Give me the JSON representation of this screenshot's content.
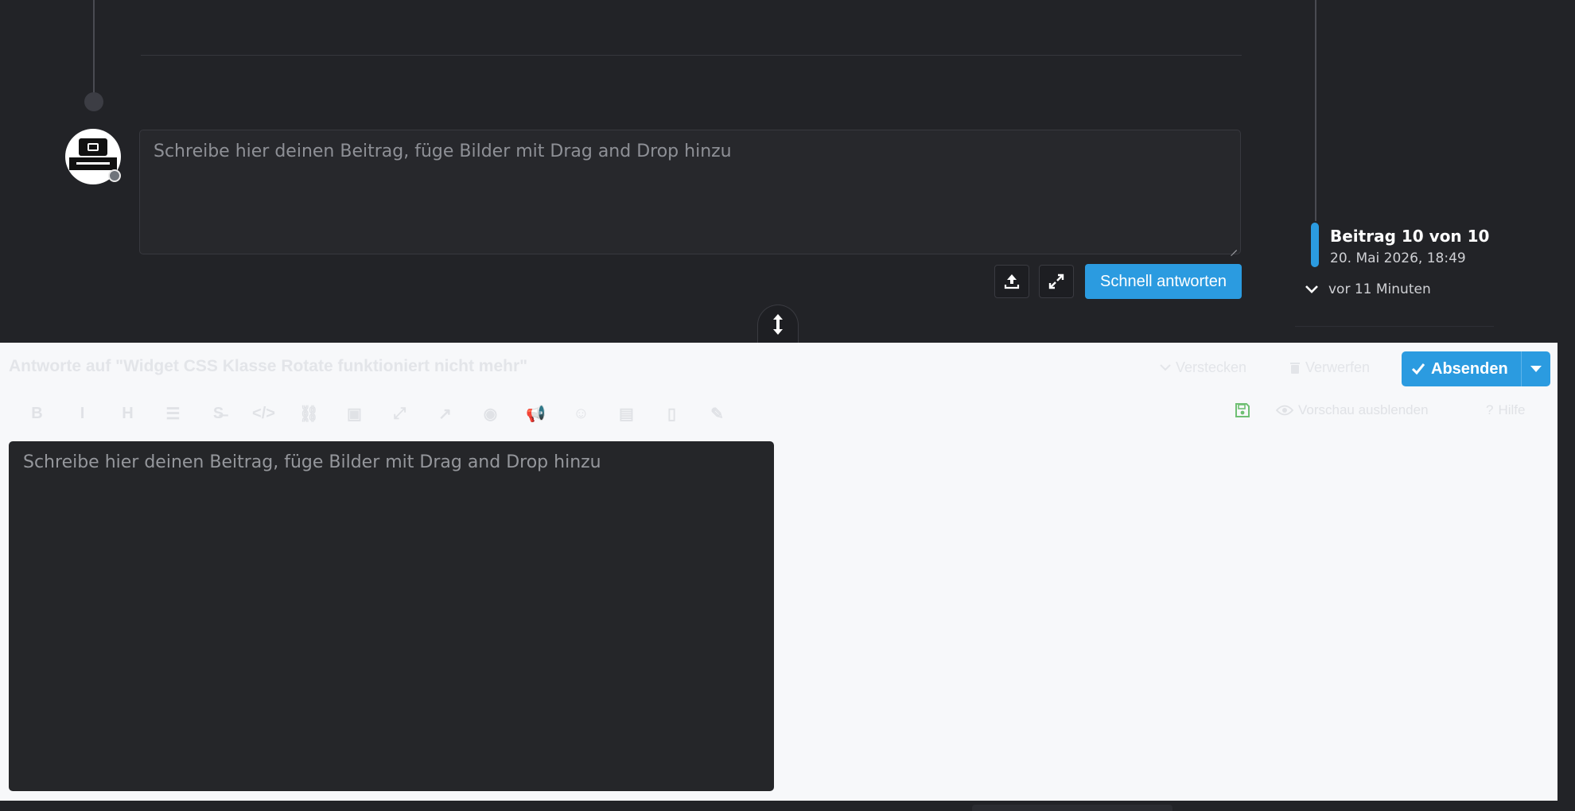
{
  "quick_reply": {
    "placeholder": "Schreibe hier deinen Beitrag, füge Bilder mit Drag and Drop hinzu",
    "submit_label": "Schnell antworten"
  },
  "timeline": {
    "position": "Beitrag 10 von 10",
    "date": "20. Mai 2026, 18:49",
    "ago": "vor 11 Minuten"
  },
  "composer": {
    "title": "Antworte auf \"Widget CSS Klasse Rotate funktioniert nicht mehr\"",
    "hide_label": "Verstecken",
    "discard_label": "Verwerfen",
    "submit_label": "Absenden",
    "toolbar": [
      {
        "icon": "bold-icon",
        "glyph": "B"
      },
      {
        "icon": "italic-icon",
        "glyph": "I"
      },
      {
        "icon": "heading-icon",
        "glyph": "H"
      },
      {
        "icon": "list-icon",
        "glyph": "☰"
      },
      {
        "icon": "strikethrough-icon",
        "glyph": "S̶"
      },
      {
        "icon": "code-icon",
        "glyph": "</>"
      },
      {
        "icon": "link-icon",
        "glyph": "⛓"
      },
      {
        "icon": "image-icon",
        "glyph": "▣"
      },
      {
        "icon": "expand-icon",
        "glyph": "⤢"
      },
      {
        "icon": "chart-icon",
        "glyph": "↗"
      },
      {
        "icon": "eye-icon",
        "glyph": "◉"
      },
      {
        "icon": "bullhorn-icon",
        "glyph": "📢"
      },
      {
        "icon": "smile-icon",
        "glyph": "☺"
      },
      {
        "icon": "file-icon",
        "glyph": "▤"
      },
      {
        "icon": "page-icon",
        "glyph": "▯"
      },
      {
        "icon": "pen-icon",
        "glyph": "✎"
      }
    ],
    "preview_label": "Vorschau ausblenden",
    "help_label": "Hilfe",
    "editor_placeholder": "Schreibe hier deinen Beitrag, füge Bilder mit Drag and Drop hinzu"
  },
  "colors": {
    "accent": "#2b9be0",
    "dark_bg": "#222327",
    "light_bg": "#f7f8fa",
    "save_green": "#6fbf73"
  }
}
